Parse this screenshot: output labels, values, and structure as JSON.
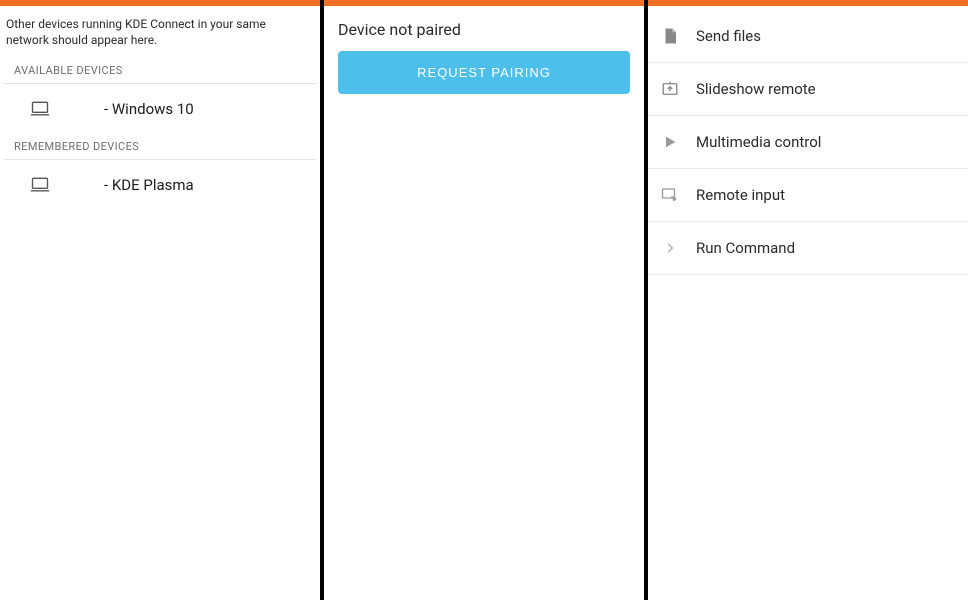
{
  "left": {
    "hint": "Other devices running KDE Connect in your same network should appear here.",
    "sections": {
      "available_header": "AVAILABLE DEVICES",
      "remembered_header": "REMEMBERED DEVICES"
    },
    "available": [
      {
        "label": "- Windows 10"
      }
    ],
    "remembered": [
      {
        "label": "- KDE Plasma"
      }
    ]
  },
  "mid": {
    "status": "Device not paired",
    "pair_button": "REQUEST PAIRING"
  },
  "right": {
    "features": [
      {
        "label": "Send files",
        "icon": "file-icon"
      },
      {
        "label": "Slideshow remote",
        "icon": "slideshow-icon"
      },
      {
        "label": "Multimedia control",
        "icon": "play-icon"
      },
      {
        "label": "Remote input",
        "icon": "remote-input-icon"
      },
      {
        "label": "Run Command",
        "icon": "chevron-right-icon"
      }
    ]
  }
}
